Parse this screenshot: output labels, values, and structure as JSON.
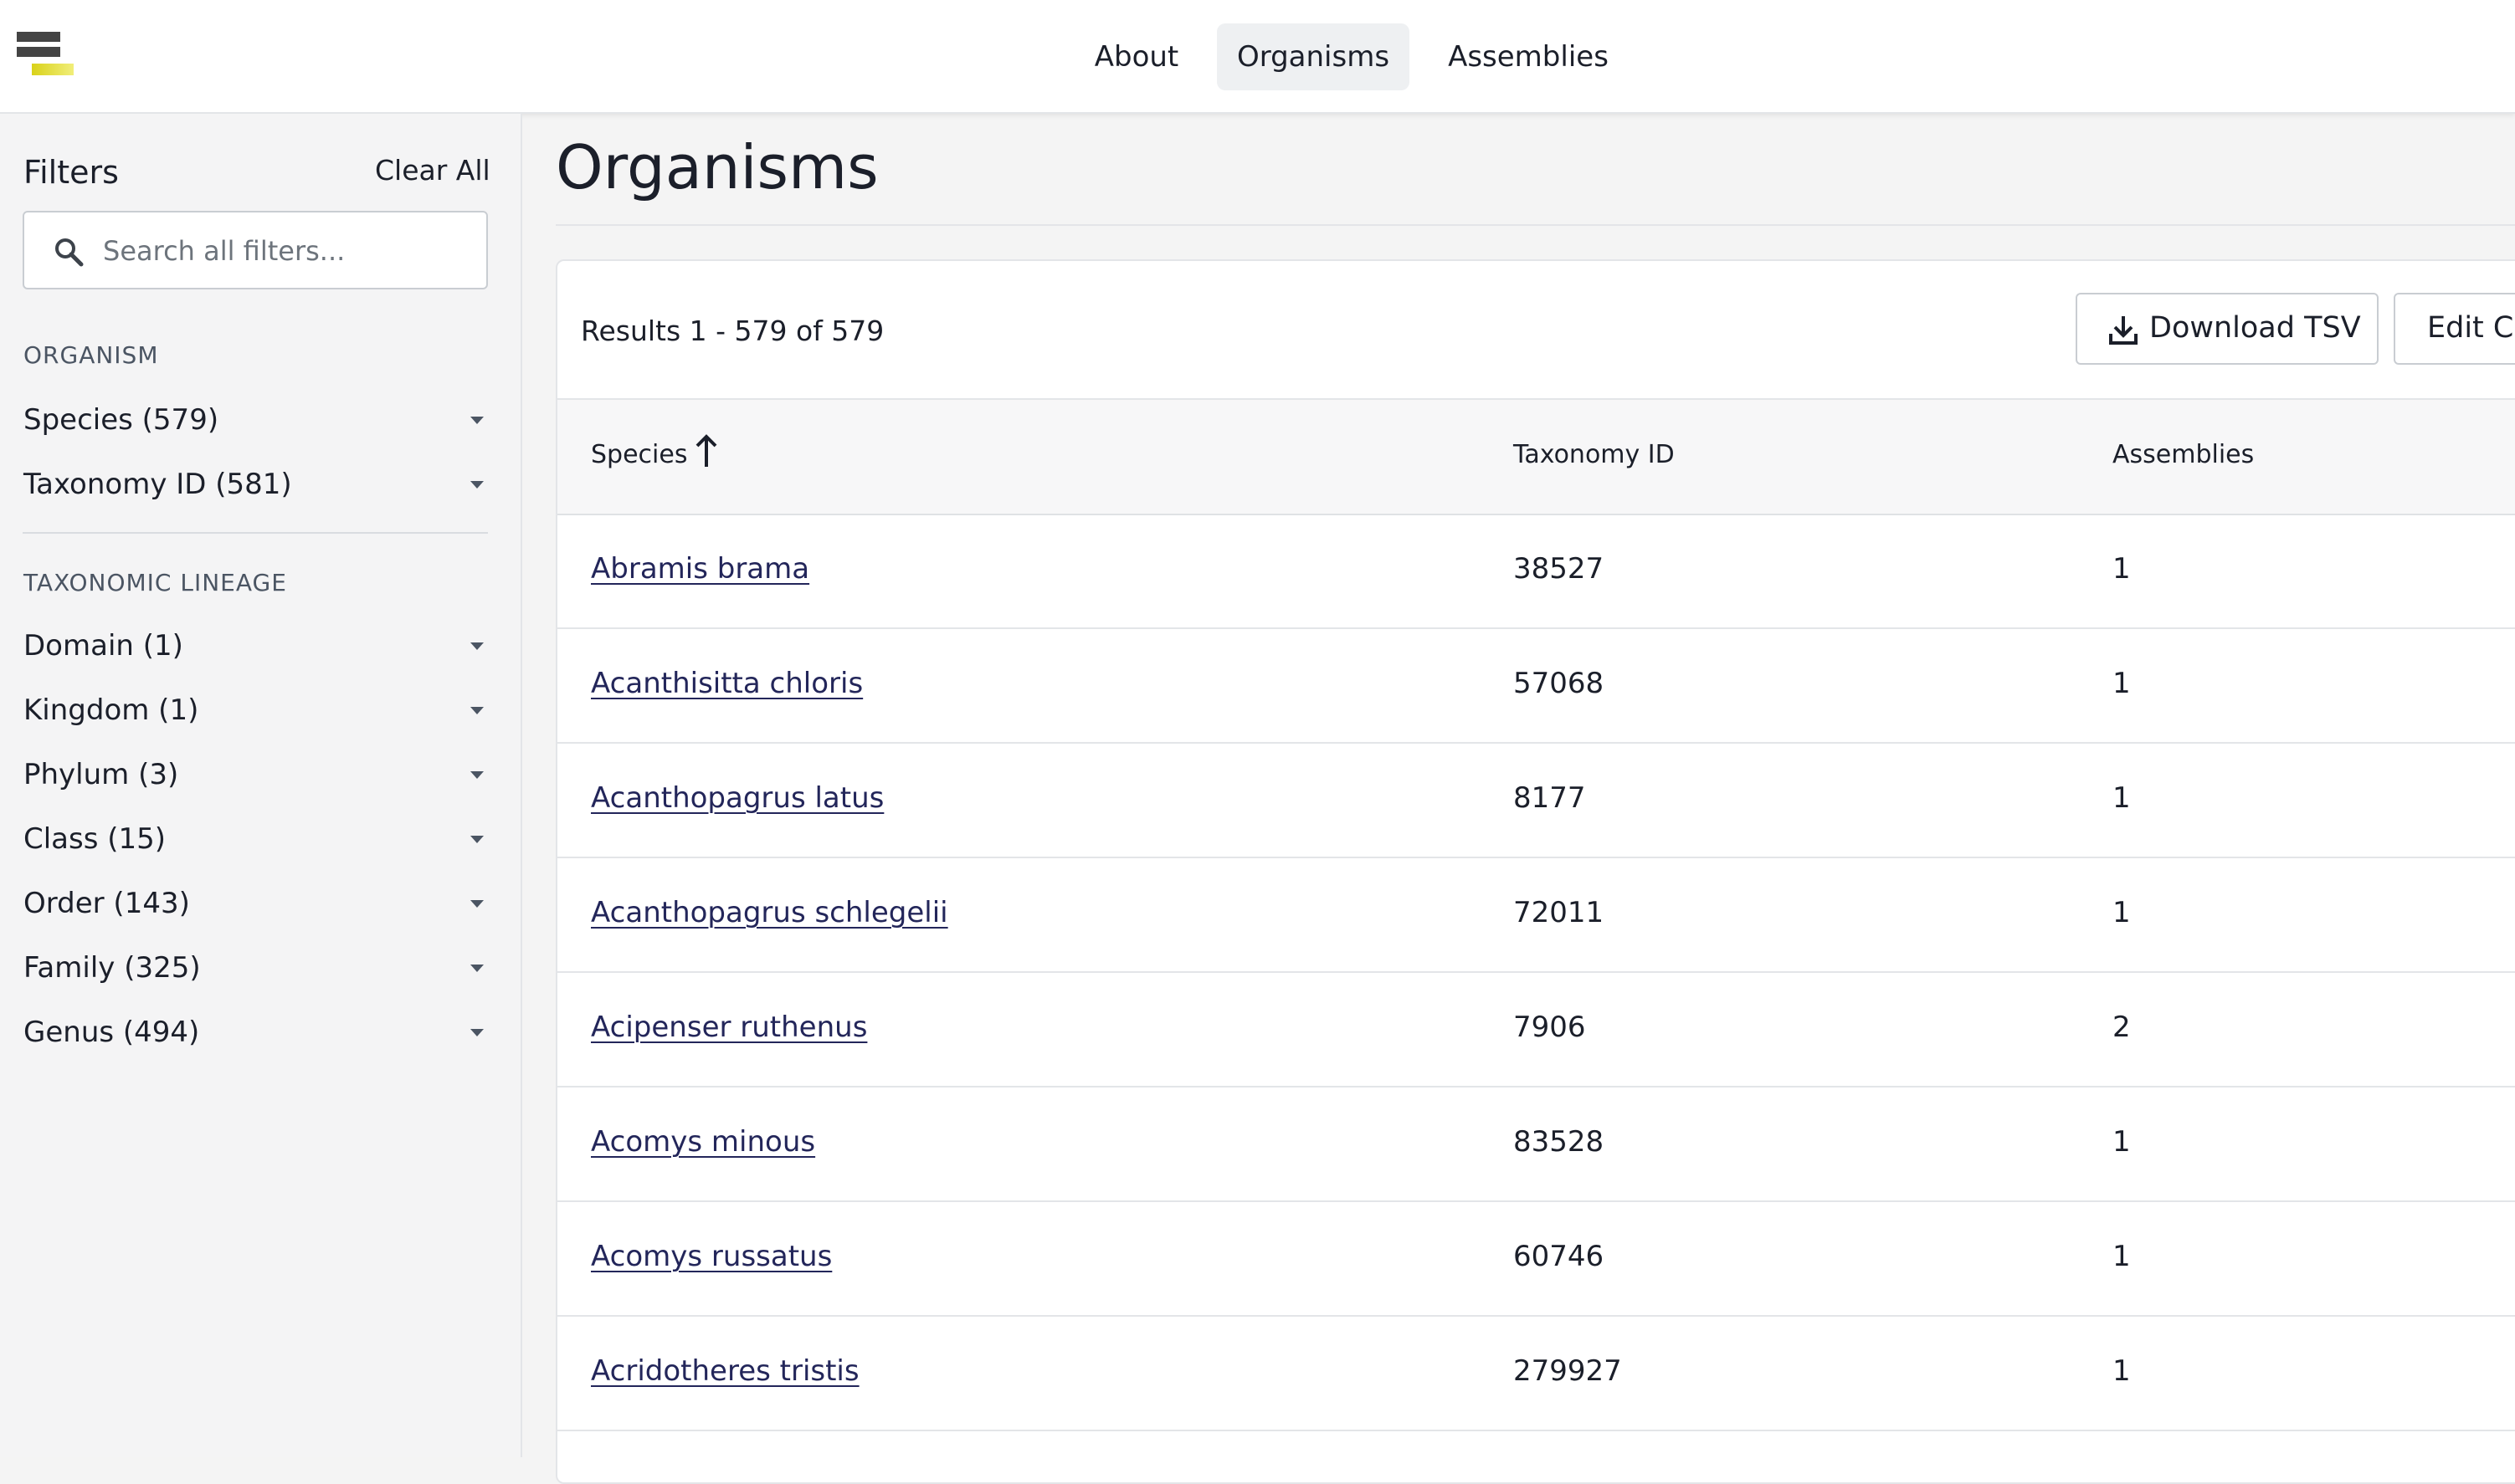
{
  "header": {
    "logo_icon": "bars-logo-icon",
    "nav": [
      {
        "label": "About",
        "active": false
      },
      {
        "label": "Organisms",
        "active": true
      },
      {
        "label": "Assemblies",
        "active": false
      }
    ]
  },
  "sidebar": {
    "title": "Filters",
    "clear_all": "Clear All",
    "search": {
      "placeholder": "Search all filters...",
      "value": "",
      "icon": "search-icon"
    },
    "sections": [
      {
        "label": "ORGANISM",
        "items": [
          {
            "label": "Species (579)"
          },
          {
            "label": "Taxonomy ID (581)"
          }
        ]
      },
      {
        "label": "TAXONOMIC LINEAGE",
        "items": [
          {
            "label": "Domain (1)"
          },
          {
            "label": "Kingdom (1)"
          },
          {
            "label": "Phylum (3)"
          },
          {
            "label": "Class (15)"
          },
          {
            "label": "Order (143)"
          },
          {
            "label": "Family (325)"
          },
          {
            "label": "Genus (494)"
          }
        ]
      }
    ]
  },
  "main": {
    "title": "Organisms",
    "results_text": "Results 1 - 579 of 579",
    "download_label": "Download TSV",
    "download_icon": "download-icon",
    "edit_label": "Edit Co",
    "columns": [
      "Species",
      "Taxonomy ID",
      "Assemblies"
    ],
    "sort_icon": "sort-ascending-arrow-icon",
    "rows": [
      {
        "species": "Abramis brama",
        "taxonomy_id": "38527",
        "assemblies": "1"
      },
      {
        "species": "Acanthisitta chloris",
        "taxonomy_id": "57068",
        "assemblies": "1"
      },
      {
        "species": "Acanthopagrus latus",
        "taxonomy_id": "8177",
        "assemblies": "1"
      },
      {
        "species": "Acanthopagrus schlegelii",
        "taxonomy_id": "72011",
        "assemblies": "1"
      },
      {
        "species": "Acipenser ruthenus",
        "taxonomy_id": "7906",
        "assemblies": "2"
      },
      {
        "species": "Acomys minous",
        "taxonomy_id": "83528",
        "assemblies": "1"
      },
      {
        "species": "Acomys russatus",
        "taxonomy_id": "60746",
        "assemblies": "1"
      },
      {
        "species": "Acridotheres tristis",
        "taxonomy_id": "279927",
        "assemblies": "1"
      }
    ]
  },
  "colors": {
    "accent_yellow": "#e6e020",
    "link": "#23265a",
    "text": "#1b1f2a"
  }
}
